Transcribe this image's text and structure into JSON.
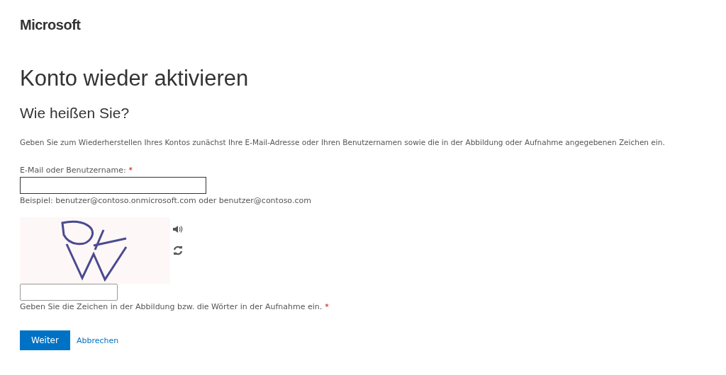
{
  "logo": {
    "text": "Microsoft"
  },
  "title": "Konto wieder aktivieren",
  "subtitle": "Wie heißen Sie?",
  "instructions": "Geben Sie zum Wiederherstellen Ihres Kontos zunächst Ihre E-Mail-Adresse oder Ihren Benutzernamen sowie die in der Abbildung oder Aufnahme angegebenen Zeichen ein.",
  "email_field": {
    "label": "E-Mail oder Benutzername:",
    "required_mark": "*",
    "example": "Beispiel: benutzer@contoso.onmicrosoft.com oder benutzer@contoso.com"
  },
  "captcha": {
    "answer_hint": "Geben Sie die Zeichen in der Abbildung bzw. die Wörter in der Aufnahme ein.",
    "required_mark": "*"
  },
  "buttons": [
    {
      "kind": "primary",
      "label": "Weiter"
    },
    {
      "kind": "link",
      "label": "Abbrechen"
    }
  ]
}
